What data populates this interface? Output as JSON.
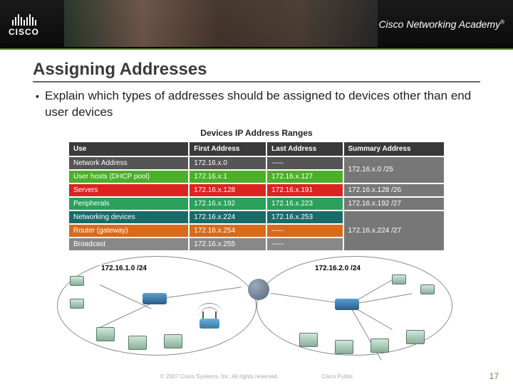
{
  "header": {
    "brand": "CISCO",
    "academy": "Cisco Networking Academy"
  },
  "slide": {
    "title": "Assigning Addresses",
    "bullet": "Explain which types of addresses should be assigned to devices other than end user devices"
  },
  "table": {
    "title": "Devices IP Address Ranges",
    "headers": [
      "Use",
      "First Address",
      "Last Address",
      "Summary Address"
    ],
    "rows": [
      {
        "cls": "row-net",
        "cells": [
          "Network Address",
          "172.16.x.0",
          "-----"
        ]
      },
      {
        "cls": "row-dhcp",
        "cells": [
          "User hosts (DHCP pool)",
          "172.16.x.1",
          "172.16.x.127"
        ]
      },
      {
        "cls": "row-srv",
        "cells": [
          "Servers",
          "172.16.x.128",
          "172.16.x.191"
        ]
      },
      {
        "cls": "row-peri",
        "cells": [
          "Peripherals",
          "172.16.x.192",
          "172.16.x.223"
        ]
      },
      {
        "cls": "row-netdv",
        "cells": [
          "Networking devices",
          "172.16.x.224",
          "172.16.x.253"
        ]
      },
      {
        "cls": "row-rtr",
        "cells": [
          "Router (gateway)",
          "172.16.x.254",
          "-----"
        ]
      },
      {
        "cls": "row-bcast",
        "cells": [
          "Broadcast",
          "172.16.x.255",
          "-----"
        ]
      }
    ],
    "summary": [
      "172.16.x.0 /25",
      "172.16.x.128 /26",
      "172.16.x.192 /27",
      "172.16.x.224 /27"
    ]
  },
  "diagram": {
    "net1": "172.16.1.0 /24",
    "net2": "172.16.2.0 /24"
  },
  "footer": {
    "copyright": "© 2007 Cisco Systems, Inc. All rights reserved.",
    "classification": "Cisco Public",
    "page": "17"
  }
}
